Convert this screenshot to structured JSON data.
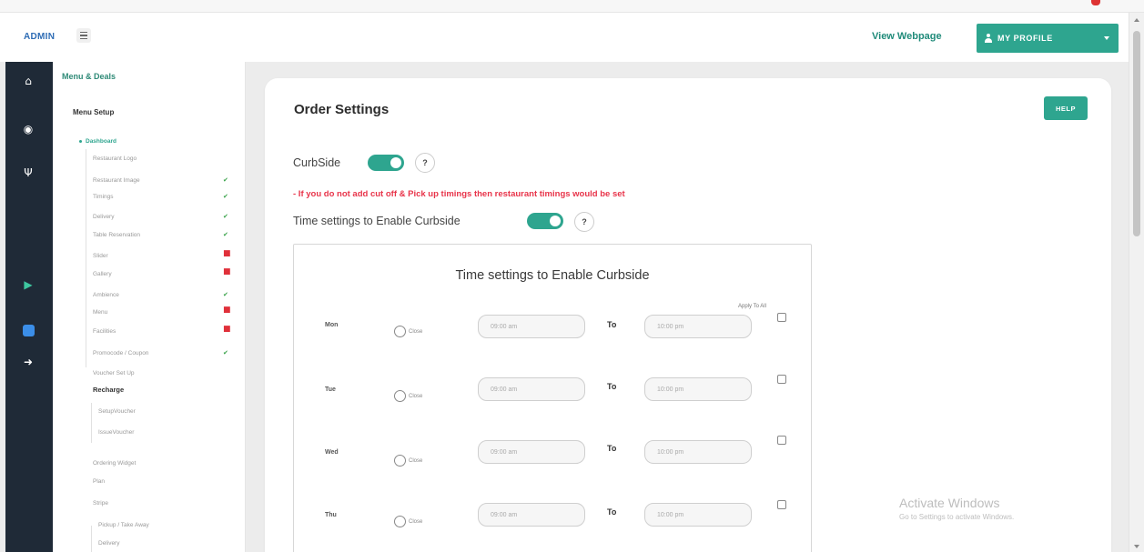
{
  "header": {
    "brand": "ADMIN",
    "view_webpage": "View Webpage",
    "profile_label": "MY PROFILE"
  },
  "rail": {
    "icons": [
      "home-icon",
      "globe-icon",
      "utensils-icon",
      "play-store-icon",
      "app-store-icon",
      "logout-icon"
    ]
  },
  "sidebar": {
    "heading": "Menu & Deals",
    "section": "Menu Setup",
    "active": "Dashboard",
    "items": [
      {
        "label": "Restaurant Logo",
        "status": ""
      },
      {
        "label": "Restaurant Image",
        "status": "done"
      },
      {
        "label": "Timings",
        "status": "done"
      },
      {
        "label": "Delivery",
        "status": "done"
      },
      {
        "label": "Table Reservation",
        "status": "done"
      },
      {
        "label": "Slider",
        "status": "missing"
      },
      {
        "label": "Gallery",
        "status": "missing"
      },
      {
        "label": "Ambience",
        "status": "done"
      },
      {
        "label": "Menu",
        "status": "missing"
      },
      {
        "label": "Facilities",
        "status": "missing"
      },
      {
        "label": "Promocode / Coupon",
        "status": "done"
      },
      {
        "label": "Voucher Set Up",
        "status": ""
      }
    ],
    "recharge": "Recharge",
    "recharge_items": [
      "SetupVoucher",
      "IssueVoucher"
    ],
    "more_items": [
      "Ordering Widget",
      "Plan",
      "Stripe"
    ],
    "stripe_items": [
      "Pickup / Take Away",
      "Delivery"
    ],
    "done_mark": "✔",
    "missing_mark": "■"
  },
  "main": {
    "title": "Order Settings",
    "help": "HELP",
    "curbside_label": "CurbSide",
    "help_mark": "?",
    "warning": "- If you do not add cut off & Pick up timings then restaurant timings would be set",
    "time_settings_label": "Time settings to Enable Curbside",
    "curbside_enabled": true,
    "time_settings_enabled": true
  },
  "time_box": {
    "title": "Time settings to Enable Curbside",
    "apply_all": "Apply To All",
    "close_label": "Close",
    "to_label": "To",
    "days": [
      {
        "day": "Mon",
        "from": "09:00 am",
        "to": "10:00 pm"
      },
      {
        "day": "Tue",
        "from": "09:00 am",
        "to": "10:00 pm"
      },
      {
        "day": "Wed",
        "from": "09:00 am",
        "to": "10:00 pm"
      },
      {
        "day": "Thu",
        "from": "09:00 am",
        "to": "10:00 pm"
      }
    ]
  },
  "watermark": {
    "line1": "Activate Windows",
    "line2": "Go to Settings to activate Windows."
  },
  "colors": {
    "accent": "#2ea58f",
    "warning": "#e8344a",
    "rail": "#1f2a37"
  }
}
